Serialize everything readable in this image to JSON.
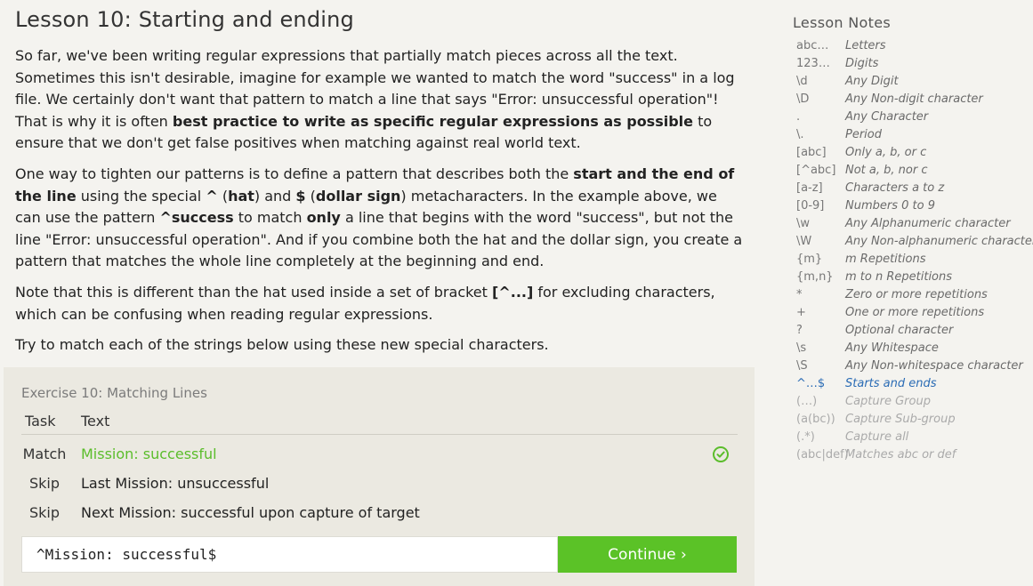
{
  "lesson": {
    "title": "Lesson 10: Starting and ending",
    "p1": {
      "a": "So far, we've been writing regular expressions that partially match pieces across all the text. Sometimes this isn't desirable, imagine for example we wanted to match the word \"success\" in a log file. We certainly don't want that pattern to match a line that says \"Error: unsuccessful operation\"! That is why it is often ",
      "b": "best practice to write as specific regular expressions as possible",
      "c": " to ensure that we don't get false positives when matching against real world text."
    },
    "p2": {
      "a": "One way to tighten our patterns is to define a pattern that describes both the ",
      "b": "start and the end of the line",
      "c": " using the special ",
      "d": "^",
      "e": " (",
      "f": "hat",
      "g": ") and ",
      "h": "$",
      "i": " (",
      "j": "dollar sign",
      "k": ") metacharacters. In the example above, we can use the pattern ",
      "l": "^success",
      "m": " to match ",
      "n": "only",
      "o": " a line that begins with the word \"success\", but not the line \"Error: unsuccessful operation\". And if you combine both the hat and the dollar sign, you create a pattern that matches the whole line completely at the beginning and end."
    },
    "p3": {
      "a": "Note that this is different than the hat used inside a set of bracket ",
      "b": "[^...]",
      "c": " for excluding characters, which can be confusing when reading regular expressions."
    },
    "p4": "Try to match each of the strings below using these new special characters."
  },
  "exercise": {
    "title": "Exercise 10: Matching Lines",
    "columns": {
      "task": "Task",
      "text": "Text"
    },
    "rows": [
      {
        "task": "Match",
        "text": "Mission: successful",
        "status": "success"
      },
      {
        "task": "Skip",
        "text": "Last Mission: unsuccessful",
        "status": ""
      },
      {
        "task": "Skip",
        "text": "Next Mission: successful upon capture of target",
        "status": ""
      }
    ],
    "input_value": "^Mission: successful$",
    "continue_label": "Continue ›",
    "check_icon": "check-circle-icon",
    "accent_color": "#5bc227"
  },
  "notes": {
    "title": "Lesson Notes",
    "items": [
      {
        "sym": "abc…",
        "desc": "Letters"
      },
      {
        "sym": "123…",
        "desc": "Digits"
      },
      {
        "sym": "\\d",
        "desc": "Any Digit"
      },
      {
        "sym": "\\D",
        "desc": "Any Non-digit character"
      },
      {
        "sym": ".",
        "desc": "Any Character"
      },
      {
        "sym": "\\.",
        "desc": "Period"
      },
      {
        "sym": "[abc]",
        "desc": "Only a, b, or c"
      },
      {
        "sym": "[^abc]",
        "desc": "Not a, b, nor c"
      },
      {
        "sym": "[a-z]",
        "desc": "Characters a to z"
      },
      {
        "sym": "[0-9]",
        "desc": "Numbers 0 to 9"
      },
      {
        "sym": "\\w",
        "desc": "Any Alphanumeric character"
      },
      {
        "sym": "\\W",
        "desc": "Any Non-alphanumeric character"
      },
      {
        "sym": "{m}",
        "desc": "m Repetitions"
      },
      {
        "sym": "{m,n}",
        "desc": "m to n Repetitions"
      },
      {
        "sym": "*",
        "desc": "Zero or more repetitions"
      },
      {
        "sym": "+",
        "desc": "One or more repetitions"
      },
      {
        "sym": "?",
        "desc": "Optional character"
      },
      {
        "sym": "\\s",
        "desc": "Any Whitespace"
      },
      {
        "sym": "\\S",
        "desc": "Any Non-whitespace character"
      },
      {
        "sym": "^…$",
        "desc": "Starts and ends",
        "state": "active"
      },
      {
        "sym": "(…)",
        "desc": "Capture Group",
        "state": "dim"
      },
      {
        "sym": "(a(bc))",
        "desc": "Capture Sub-group",
        "state": "dim"
      },
      {
        "sym": "(.*)",
        "desc": "Capture all",
        "state": "dim"
      },
      {
        "sym": "(abc|def)",
        "desc": "Matches abc or def",
        "state": "dim"
      }
    ]
  }
}
